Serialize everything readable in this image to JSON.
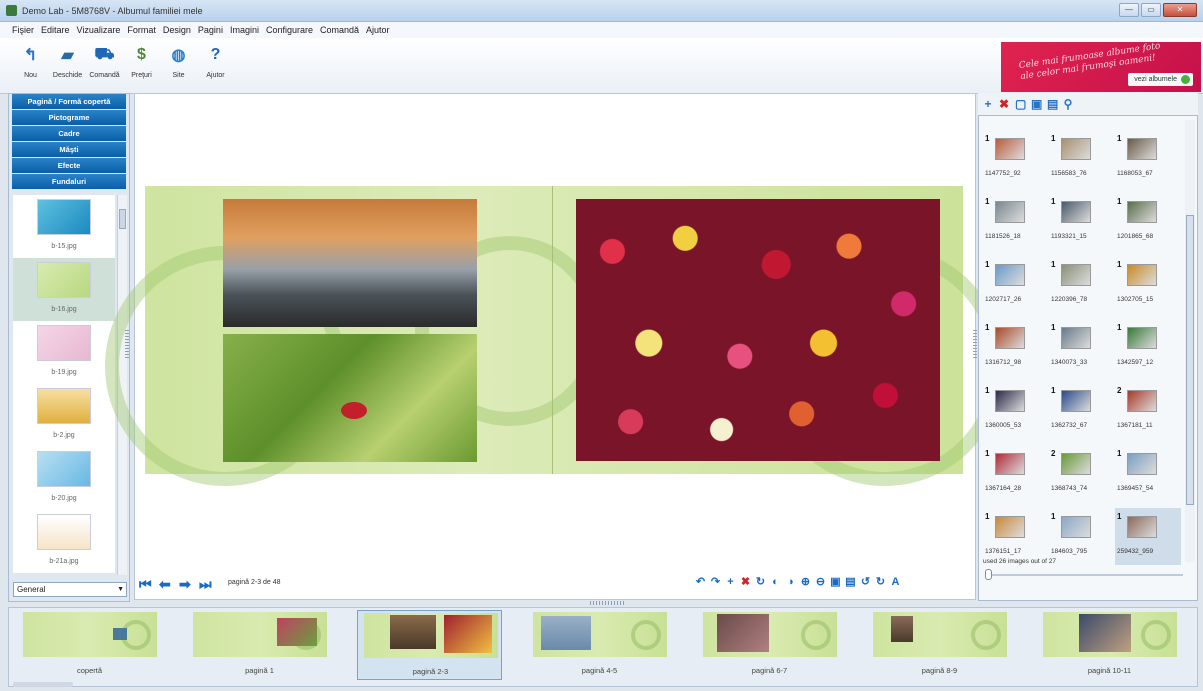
{
  "window": {
    "title": "Demo Lab - 5M8768V - Albumul familiei mele",
    "minimize": "—",
    "maximize": "▭",
    "close": "✕"
  },
  "menu": [
    "Fişier",
    "Editare",
    "Vizualizare",
    "Format",
    "Design",
    "Pagini",
    "Imagini",
    "Configurare",
    "Comandă",
    "Ajutor"
  ],
  "toolbar": [
    {
      "label": "Nou",
      "icon": "new-document-icon",
      "glyph": "↰",
      "color": "#2a72c4"
    },
    {
      "label": "Deschide",
      "icon": "open-folder-icon",
      "glyph": "▰",
      "color": "#2a6aa8"
    },
    {
      "label": "Comandă",
      "icon": "cart-icon",
      "glyph": "⛟",
      "color": "#1f68b8"
    },
    {
      "label": "Preţuri",
      "icon": "money-icon",
      "glyph": "$",
      "color": "#4c8a38"
    },
    {
      "label": "Site",
      "icon": "globe-icon",
      "glyph": "◍",
      "color": "#2b7ec4"
    },
    {
      "label": "Ajutor",
      "icon": "help-icon",
      "glyph": "?",
      "color": "#1f64b8"
    }
  ],
  "banner": {
    "text_line1": "Cele mai frumoase albume foto",
    "text_line2": "ale celor mai frumoşi oameni!",
    "button_label": "vezi albumele"
  },
  "left_panel": {
    "categories": [
      "Pagină / Formă copertă",
      "Pictograme",
      "Cadre",
      "Măşti",
      "Efecte",
      "Fundaluri"
    ],
    "backgrounds": [
      {
        "label": "b-15.jpg",
        "color": "linear-gradient(135deg,#5fc0e0,#1a8ac0)",
        "selected": false
      },
      {
        "label": "b-16.jpg",
        "color": "linear-gradient(135deg,#d8ebb0,#b8d880)",
        "selected": true
      },
      {
        "label": "b-19.jpg",
        "color": "linear-gradient(135deg,#f4d6e8,#e8b8d0)",
        "selected": false
      },
      {
        "label": "b-2.jpg",
        "color": "linear-gradient(#f6e0a0,#e0b040)",
        "selected": false
      },
      {
        "label": "b-20.jpg",
        "color": "linear-gradient(135deg,#b8dff2,#68b8e4)",
        "selected": false
      },
      {
        "label": "b-21a.jpg",
        "color": "linear-gradient(#ffffff,#f6e4c8)",
        "selected": false
      }
    ],
    "dropdown_value": "General"
  },
  "canvas": {
    "page_indicator": "pagină 2-3 de 48"
  },
  "right_panel": {
    "images": [
      {
        "count": "1",
        "name": "1147752_92",
        "color": "#b85c3c"
      },
      {
        "count": "1",
        "name": "1156583_76",
        "color": "#a89070"
      },
      {
        "count": "1",
        "name": "1168053_67",
        "color": "#6a5a48"
      },
      {
        "count": "1",
        "name": "1181526_18",
        "color": "#7a8890"
      },
      {
        "count": "1",
        "name": "1193321_15",
        "color": "#4a5a6a"
      },
      {
        "count": "1",
        "name": "1201865_68",
        "color": "#5a6e4a"
      },
      {
        "count": "1",
        "name": "1202717_26",
        "color": "#6a9ac8"
      },
      {
        "count": "1",
        "name": "1220396_78",
        "color": "#8a9078"
      },
      {
        "count": "1",
        "name": "1302705_15",
        "color": "#c88a28"
      },
      {
        "count": "1",
        "name": "1316712_98",
        "color": "#a84a2a"
      },
      {
        "count": "1",
        "name": "1340073_33",
        "color": "#6a7a8a"
      },
      {
        "count": "1",
        "name": "1342597_12",
        "color": "#3a7a3a"
      },
      {
        "count": "1",
        "name": "1360005_53",
        "color": "#2a2a4a"
      },
      {
        "count": "1",
        "name": "1362732_67",
        "color": "#2a4a8a"
      },
      {
        "count": "2",
        "name": "1367181_11",
        "color": "#a83a2a"
      },
      {
        "count": "1",
        "name": "1367164_28",
        "color": "#b02a3a"
      },
      {
        "count": "2",
        "name": "1368743_74",
        "color": "#6a9a3a"
      },
      {
        "count": "1",
        "name": "1369457_54",
        "color": "#7aa0c0"
      },
      {
        "count": "1",
        "name": "1376151_17",
        "color": "#c88a3a"
      },
      {
        "count": "1",
        "name": "184603_795",
        "color": "#8aa8c8"
      },
      {
        "count": "1",
        "name": "259432_959",
        "color": "#8a6a5a",
        "selected": true
      }
    ],
    "used_text": "used 26 images out of 27"
  },
  "filmstrip": [
    {
      "label": "copertă",
      "selected": false
    },
    {
      "label": "pagină 1",
      "selected": false
    },
    {
      "label": "pagină 2-3",
      "selected": true
    },
    {
      "label": "pagină 4-5",
      "selected": false
    },
    {
      "label": "pagină 6-7",
      "selected": false
    },
    {
      "label": "pagină 8-9",
      "selected": false
    },
    {
      "label": "pagină 10-11",
      "selected": false
    }
  ]
}
